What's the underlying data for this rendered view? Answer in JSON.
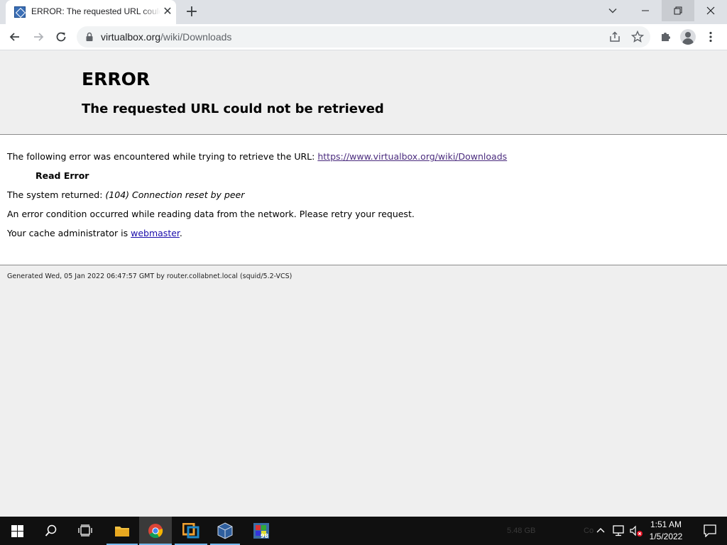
{
  "browser": {
    "tab_title": "ERROR: The requested URL could not be retrieved",
    "url_host": "virtualbox.org",
    "url_path": "/wiki/Downloads",
    "tab_close": "✕",
    "new_tab": "+"
  },
  "error_page": {
    "heading": "ERROR",
    "subheading": "The requested URL could not be retrieved",
    "intro_text": "The following error was encountered while trying to retrieve the URL: ",
    "url_link": "https://www.virtualbox.org/wiki/Downloads",
    "error_name": "Read Error",
    "system_returned_label": "The system returned: ",
    "system_returned_value": "(104) Connection reset by peer",
    "condition_text": "An error condition occurred while reading data from the network. Please retry your request.",
    "admin_text": "Your cache administrator is ",
    "admin_link": "webmaster",
    "admin_suffix": ".",
    "footer": "Generated Wed, 05 Jan 2022 06:47:57 GMT by router.collabnet.local (squid/5.2-VCS)"
  },
  "taskbar": {
    "time": "1:51 AM",
    "date": "1/5/2022",
    "apps": [
      "start-icon",
      "search-icon",
      "task-view-icon",
      "file-explorer-icon",
      "chrome-icon",
      "vmware-icon",
      "virtualbox-icon",
      "win98-icon"
    ],
    "ghost_text_1": "5.48 GB",
    "ghost_text_2": "Co"
  },
  "colors": {
    "tab_bar": "#dee1e6",
    "link": "#1a0dab",
    "visited_link": "#4b2c7e",
    "taskbar": "#101010"
  }
}
